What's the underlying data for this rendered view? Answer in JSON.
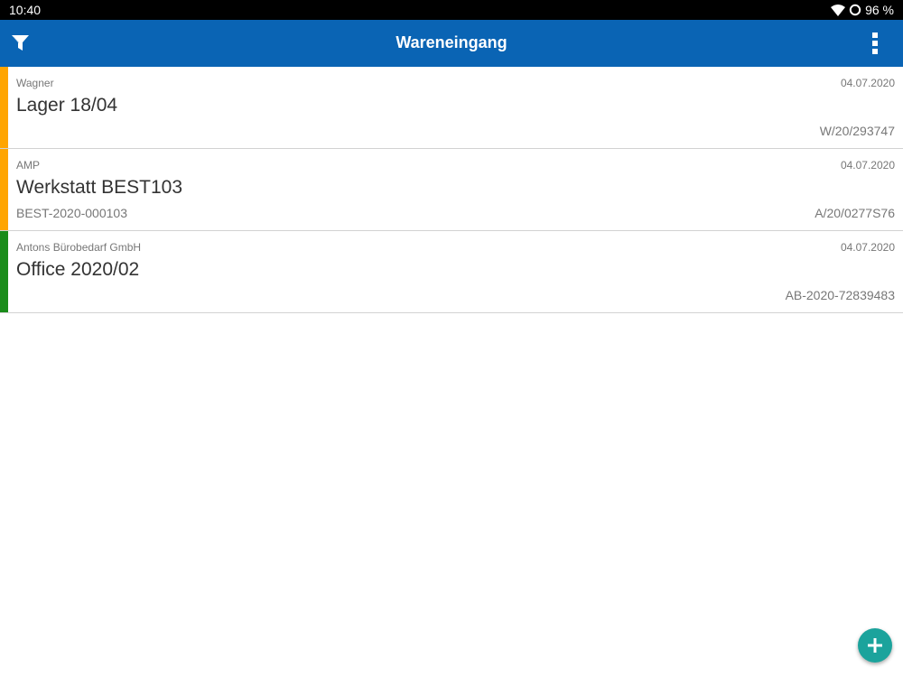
{
  "status_bar": {
    "time": "10:40",
    "battery": "96 %",
    "icons": [
      "wifi-icon",
      "battery-ring-icon"
    ]
  },
  "app_bar": {
    "title": "Wareneingang",
    "left_icon": "filter-icon",
    "right_icon": "more-vert-icon",
    "color": "#0a64b4"
  },
  "receipts": [
    {
      "supplier": "Wagner",
      "date": "04.07.2020",
      "title": "Lager 18/04",
      "order_no": "",
      "doc_no": "W/20/293747",
      "status_color": "#ffa500"
    },
    {
      "supplier": "AMP",
      "date": "04.07.2020",
      "title": "Werkstatt BEST103",
      "order_no": "BEST-2020-000103",
      "doc_no": "A/20/0277S76",
      "status_color": "#ffa500"
    },
    {
      "supplier": "Antons Bürobedarf GmbH",
      "date": "04.07.2020",
      "title": "Office 2020/02",
      "order_no": "",
      "doc_no": "AB-2020-72839483",
      "status_color": "#1a8c1a"
    }
  ],
  "fab": {
    "icon": "plus-icon",
    "color": "#1ba39c"
  }
}
